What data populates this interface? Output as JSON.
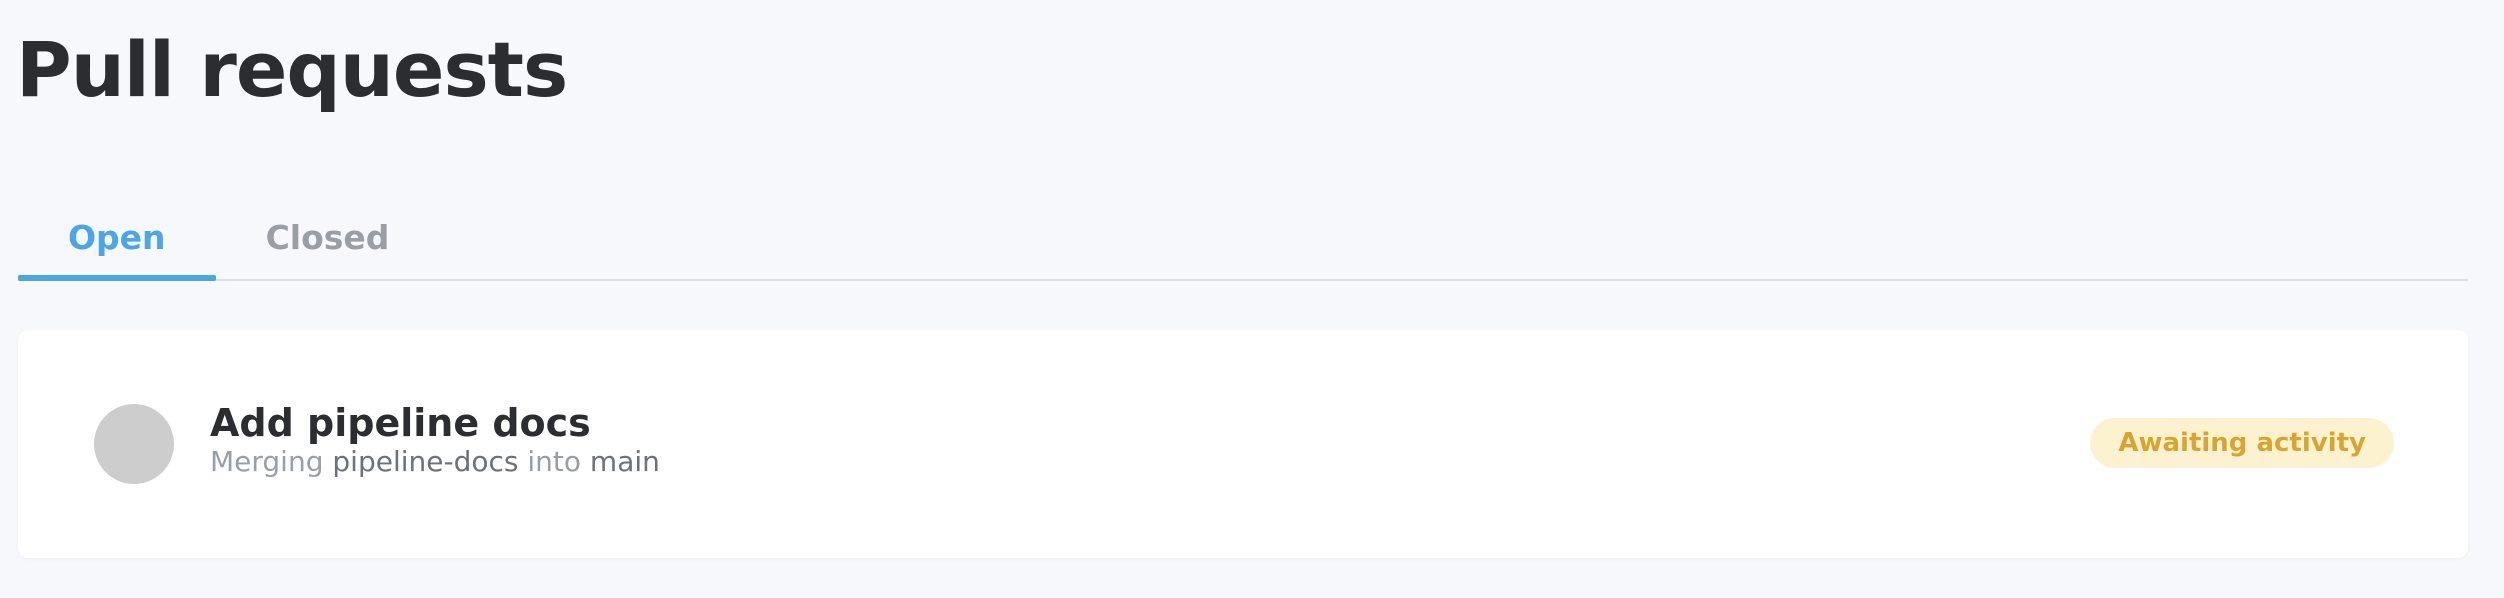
{
  "page": {
    "title": "Pull requests"
  },
  "tabs": [
    {
      "label": "Open",
      "active": true
    },
    {
      "label": "Closed",
      "active": false
    }
  ],
  "pull_requests": [
    {
      "title": "Add pipeline docs",
      "merging_word": "Merging",
      "source_branch": "pipeline-docs",
      "into_word": "into",
      "target_branch": "main",
      "status": "Awaiting activity",
      "avatar_color": "#cdcdcd"
    }
  ],
  "colors": {
    "accent": "#4aa6e8",
    "background": "#f7f8fb",
    "status_bg": "#fdf2cf",
    "status_text": "#d9a531"
  }
}
